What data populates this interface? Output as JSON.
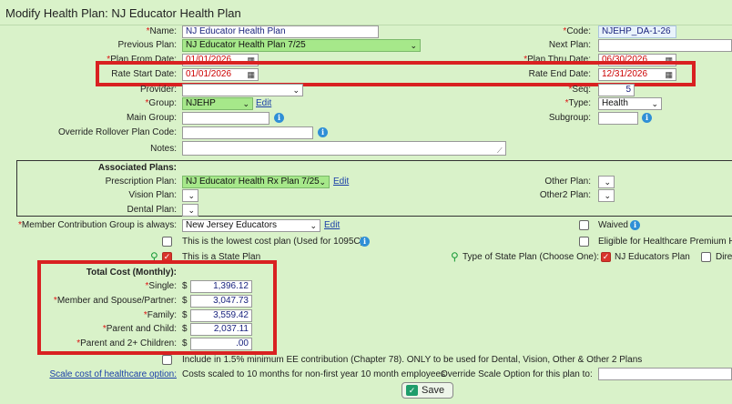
{
  "title": "Modify Health Plan: NJ Educator Health Plan",
  "fields": {
    "name": {
      "label": "Name:",
      "value": "NJ Educator Health Plan"
    },
    "code": {
      "label": "Code:",
      "value": "NJEHP_DA-1-26"
    },
    "previous_plan": {
      "label": "Previous Plan:",
      "value": "NJ Educator Health Plan 7/25"
    },
    "next_plan": {
      "label": "Next Plan:",
      "value": ""
    },
    "plan_from_date": {
      "label": "Plan From Date:",
      "value": "01/01/2026"
    },
    "plan_thru_date": {
      "label": "Plan Thru Date:",
      "value": "06/30/2026"
    },
    "rate_start_date": {
      "label": "Rate Start Date:",
      "value": "01/01/2026"
    },
    "rate_end_date": {
      "label": "Rate End Date:",
      "value": "12/31/2026"
    },
    "provider": {
      "label": "Provider:",
      "value": ""
    },
    "seq": {
      "label": "Seq:",
      "value": "5"
    },
    "group": {
      "label": "Group:",
      "value": "NJEHP",
      "edit": "Edit"
    },
    "type": {
      "label": "Type:",
      "value": "Health"
    },
    "main_group": {
      "label": "Main Group:",
      "value": ""
    },
    "subgroup": {
      "label": "Subgroup:",
      "value": ""
    },
    "override_rollover": {
      "label": "Override Rollover Plan Code:",
      "value": ""
    },
    "notes": {
      "label": "Notes:",
      "value": ""
    }
  },
  "associated": {
    "heading": "Associated Plans:",
    "prescription": {
      "label": "Prescription Plan:",
      "value": "NJ Educator Health Rx Plan 7/25",
      "edit": "Edit"
    },
    "vision": {
      "label": "Vision Plan:"
    },
    "dental": {
      "label": "Dental Plan:"
    },
    "other": {
      "label": "Other Plan:"
    },
    "other2": {
      "label": "Other2 Plan:"
    }
  },
  "contribution": {
    "label": "Member Contribution Group is always:",
    "value": "New Jersey Educators",
    "edit": "Edit",
    "waived": "Waived",
    "lowest_cost": "This is the lowest cost plan (Used for 1095C)",
    "eligible_premium": "Eligible for Healthcare Premium Ho",
    "state_plan": "This is a State Plan",
    "type_of_state_plan": "Type of State Plan (Choose One):",
    "nj_educators": "NJ Educators Plan",
    "direct": "Dire"
  },
  "total_cost": {
    "heading": "Total Cost (Monthly):",
    "currency": "$",
    "rows": [
      {
        "label": "Single:",
        "value": "1,396.12"
      },
      {
        "label": "Member and Spouse/Partner:",
        "value": "3,047.73"
      },
      {
        "label": "Family:",
        "value": "3,559.42"
      },
      {
        "label": "Parent and Child:",
        "value": "2,037.11"
      },
      {
        "label": "Parent and 2+ Children:",
        "value": ".00"
      }
    ]
  },
  "footer": {
    "minimum_ee": "Include in 1.5% minimum EE contribution (Chapter 78). ONLY to be used for Dental, Vision, Other & Other 2 Plans",
    "scale_link": "Scale cost of healthcare option:",
    "scale_text": "Costs scaled to 10 months for non-first year 10 month employees",
    "override_scale": "Override Scale Option for this plan to:",
    "save": "Save"
  },
  "colors": {
    "background": "#d9f2c9",
    "highlight": "#d92121",
    "green_select": "#a6e88a",
    "link": "#1a3fa8"
  },
  "icons": [
    "info-icon",
    "calendar-icon",
    "chevron-down-icon",
    "puzzle-icon",
    "save-icon"
  ]
}
